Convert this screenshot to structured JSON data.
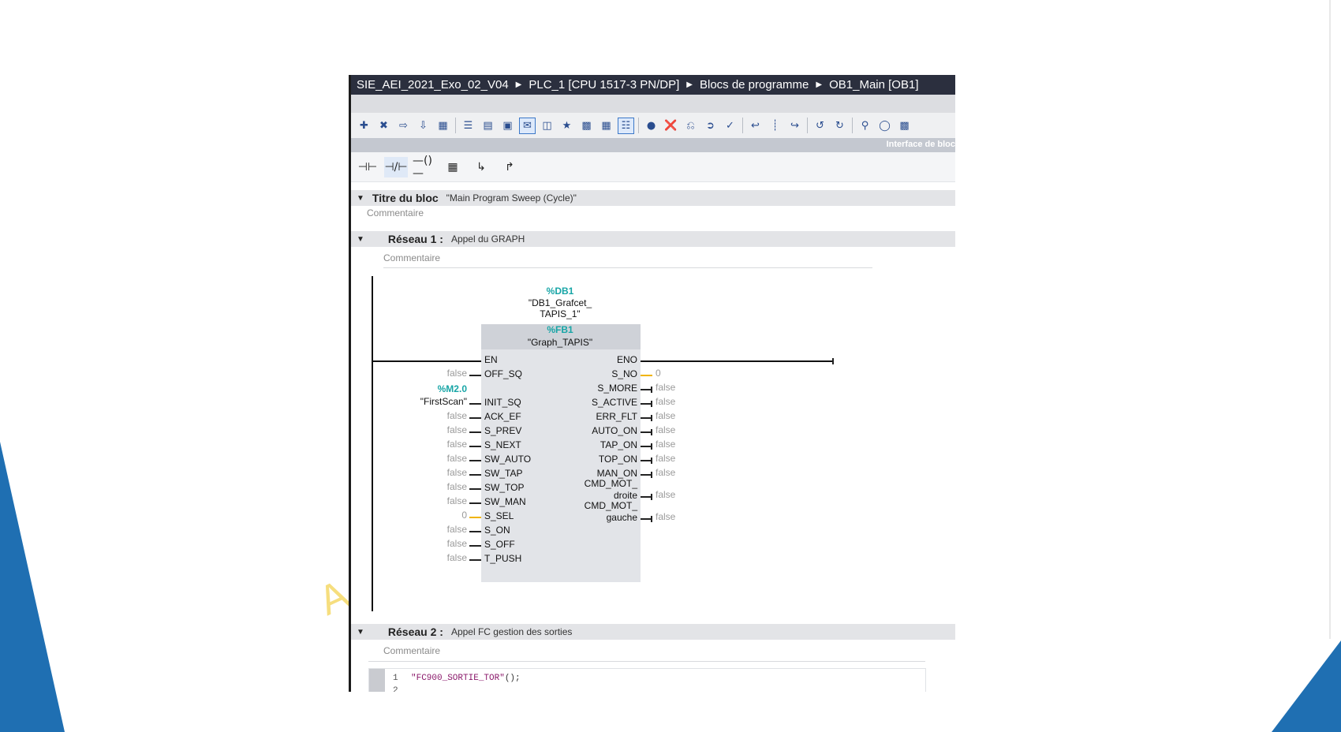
{
  "breadcrumb": {
    "project": "SIE_AEI_2021_Exo_02_V04",
    "device": "PLC_1 [CPU 1517-3 PN/DP]",
    "folder": "Blocs de programme",
    "block": "OB1_Main [OB1]"
  },
  "interface_label": "Interface de bloc",
  "block_title": {
    "label": "Titre du bloc",
    "value": "\"Main Program Sweep (Cycle)\"",
    "comment": "Commentaire"
  },
  "network1": {
    "label": "Réseau 1 :",
    "title": "Appel du GRAPH",
    "comment": "Commentaire",
    "instance_db": "%DB1",
    "instance_name_1": "\"DB1_Grafcet_",
    "instance_name_2": "TAPIS_1\"",
    "fb_address": "%FB1",
    "fb_name": "\"Graph_TAPIS\"",
    "inputs": [
      {
        "name": "EN",
        "value": ""
      },
      {
        "name": "OFF_SQ",
        "value": "false"
      },
      {
        "name": "INIT_SQ",
        "value": "\"FirstScan\"",
        "address": "%M2.0"
      },
      {
        "name": "ACK_EF",
        "value": "false"
      },
      {
        "name": "S_PREV",
        "value": "false"
      },
      {
        "name": "S_NEXT",
        "value": "false"
      },
      {
        "name": "SW_AUTO",
        "value": "false"
      },
      {
        "name": "SW_TAP",
        "value": "false"
      },
      {
        "name": "SW_TOP",
        "value": "false"
      },
      {
        "name": "SW_MAN",
        "value": "false"
      },
      {
        "name": "S_SEL",
        "value": "0"
      },
      {
        "name": "S_ON",
        "value": "false"
      },
      {
        "name": "S_OFF",
        "value": "false"
      },
      {
        "name": "T_PUSH",
        "value": "false"
      }
    ],
    "outputs": [
      {
        "name": "ENO",
        "value": ""
      },
      {
        "name": "S_NO",
        "value": "0"
      },
      {
        "name": "S_MORE",
        "value": "false"
      },
      {
        "name": "S_ACTIVE",
        "value": "false"
      },
      {
        "name": "ERR_FLT",
        "value": "false"
      },
      {
        "name": "AUTO_ON",
        "value": "false"
      },
      {
        "name": "TAP_ON",
        "value": "false"
      },
      {
        "name": "TOP_ON",
        "value": "false"
      },
      {
        "name": "MAN_ON",
        "value": "false"
      },
      {
        "name": "CMD_MOT_droite",
        "line1": "CMD_MOT_",
        "line2": "droite",
        "value": "false"
      },
      {
        "name": "CMD_MOT_gauche",
        "line1": "CMD_MOT_",
        "line2": "gauche",
        "value": "false"
      }
    ]
  },
  "network2": {
    "label": "Réseau 2 :",
    "title": "Appel FC gestion des sorties",
    "comment": "Commentaire",
    "code_lines": [
      {
        "num": "1",
        "text": "\"FC900_SORTIE_TOR\"",
        "punct": "();"
      },
      {
        "num": "2",
        "text": "",
        "punct": ""
      }
    ]
  },
  "colors": {
    "titlebar": "#2b2f3e",
    "teal_address": "#17a5a6",
    "orange_wire": "#f0b400",
    "slide_blue": "#1f6fb2"
  },
  "icons": [
    "add-network-icon",
    "delete-network-icon",
    "insert-row-icon",
    "insert-row-below-icon",
    "properties-icon",
    "network-list-icon",
    "open-all-networks-icon",
    "close-all-networks-icon",
    "comments-icon",
    "absolute-operands-icon",
    "favorites-icon",
    "call-block-icon",
    "parameter-icon",
    "display-icon",
    "monitoring-icon",
    "breakpoint-icon",
    "remove-breakpoint-icon",
    "go-to-icon",
    "go-to-next-icon",
    "download-icon",
    "step-back-icon",
    "step-line-icon",
    "step-next-icon",
    "go-up-icon",
    "go-down-icon",
    "search-icon",
    "monitor-glasses-icon",
    "lock-icon"
  ]
}
